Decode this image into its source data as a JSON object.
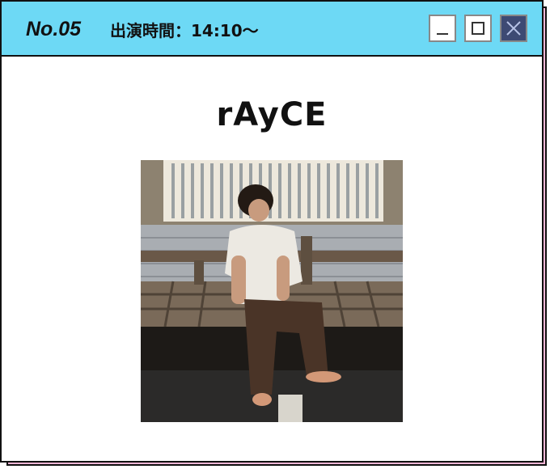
{
  "window": {
    "number": "No.05",
    "time": "出演時間：14:10〜",
    "controls": [
      "minimize",
      "maximize",
      "close"
    ]
  },
  "artist": {
    "name": "rAyCE"
  },
  "photo": {
    "subject": "person-icon"
  },
  "colors": {
    "titlebar": "#6dd9f5",
    "shadow": "#f7b6d6",
    "close_button": "#3d4a73"
  }
}
